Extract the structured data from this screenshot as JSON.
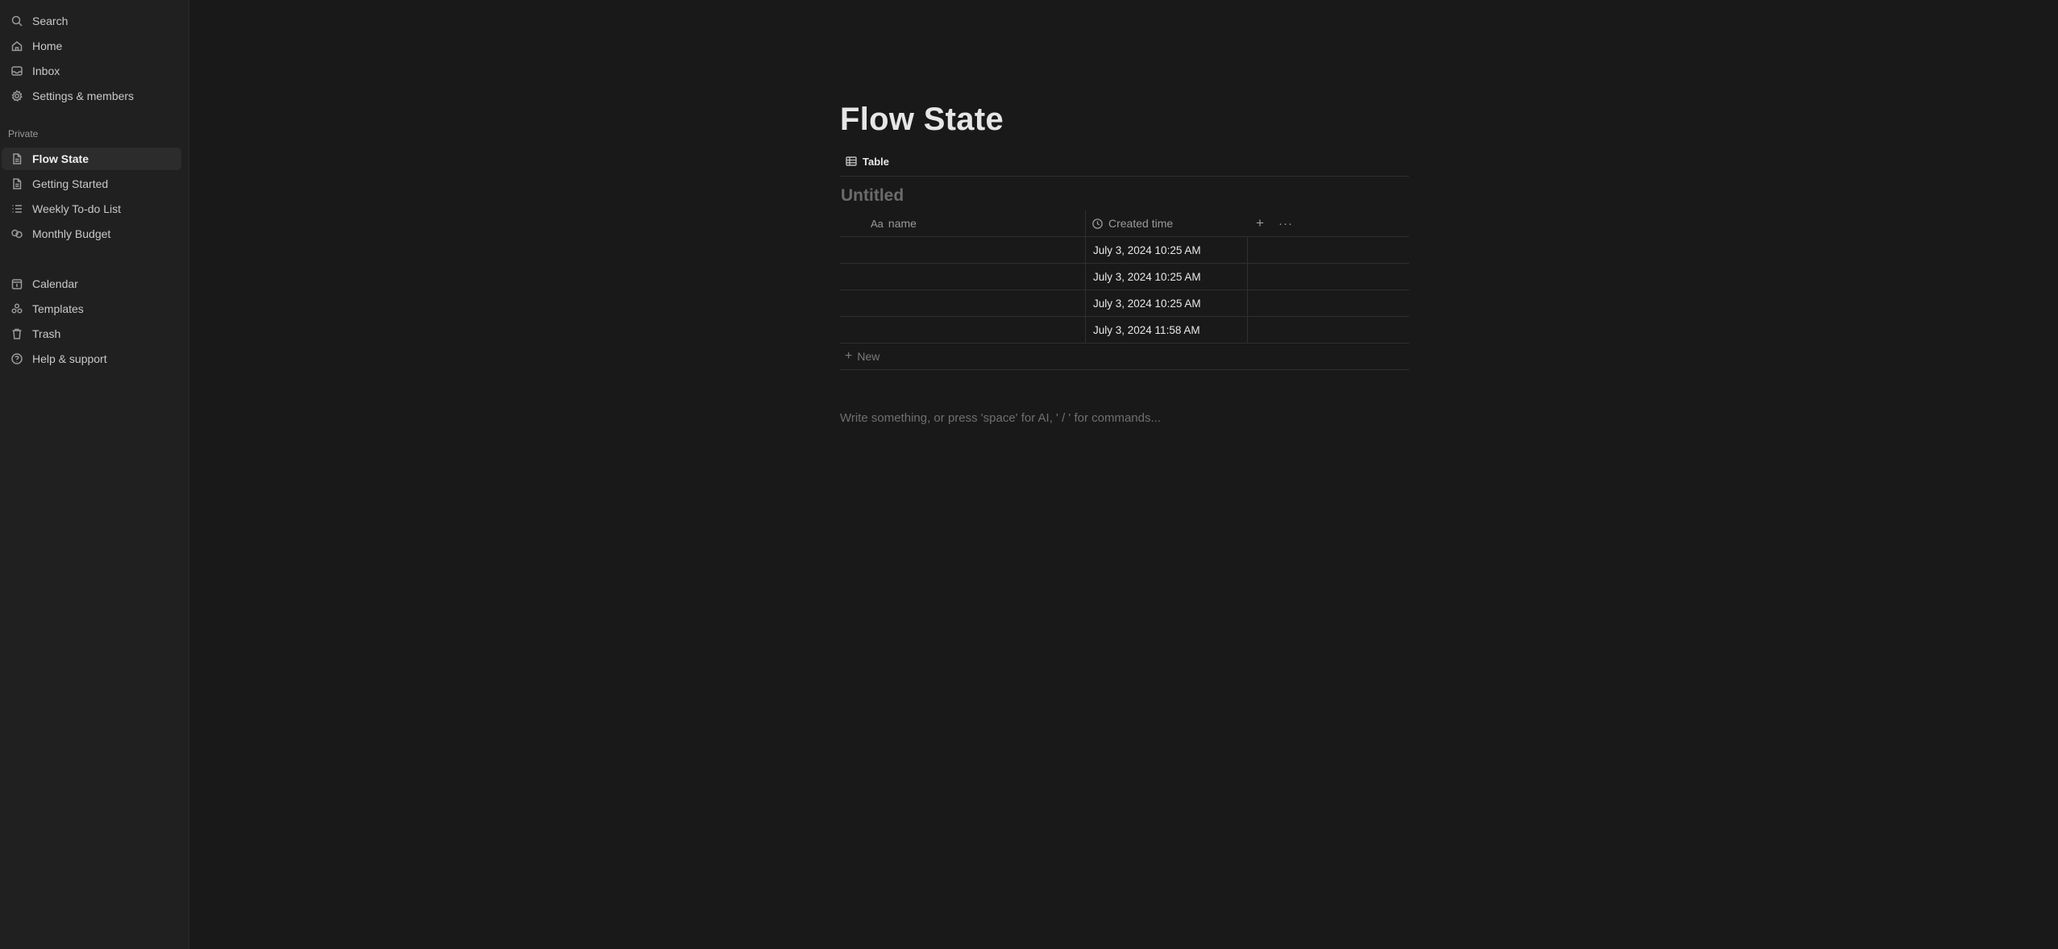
{
  "sidebar": {
    "top_items": [
      {
        "label": "Search",
        "icon": "search-icon"
      },
      {
        "label": "Home",
        "icon": "home-icon"
      },
      {
        "label": "Inbox",
        "icon": "inbox-icon"
      },
      {
        "label": "Settings & members",
        "icon": "gear-icon"
      }
    ],
    "section_label": "Private",
    "pages": [
      {
        "label": "Flow State",
        "icon": "page-icon",
        "active": true
      },
      {
        "label": "Getting Started",
        "icon": "page-icon"
      },
      {
        "label": "Weekly To-do List",
        "icon": "list-icon"
      },
      {
        "label": "Monthly Budget",
        "icon": "budget-icon"
      }
    ],
    "bottom_items": [
      {
        "label": "Calendar",
        "icon": "calendar-icon"
      },
      {
        "label": "Templates",
        "icon": "templates-icon"
      },
      {
        "label": "Trash",
        "icon": "trash-icon"
      },
      {
        "label": "Help & support",
        "icon": "help-icon"
      }
    ]
  },
  "page": {
    "title": "Flow State",
    "view_tab": "Table",
    "database_title": "Untitled",
    "placeholder": "Write something, or press 'space' for AI, ' / ' for commands..."
  },
  "table": {
    "name_column": {
      "prefix": "Aa",
      "label": "name"
    },
    "time_column": "Created time",
    "add_column": "+",
    "more": "···",
    "rows": [
      {
        "name": "",
        "created": "July 3, 2024 10:25 AM"
      },
      {
        "name": "",
        "created": "July 3, 2024 10:25 AM"
      },
      {
        "name": "",
        "created": "July 3, 2024 10:25 AM"
      },
      {
        "name": "",
        "created": "July 3, 2024 11:58 AM"
      }
    ],
    "new_label": "New"
  },
  "colors": {
    "background": "#191919",
    "sidebar": "#202020",
    "active_item": "#2c2c2c"
  }
}
